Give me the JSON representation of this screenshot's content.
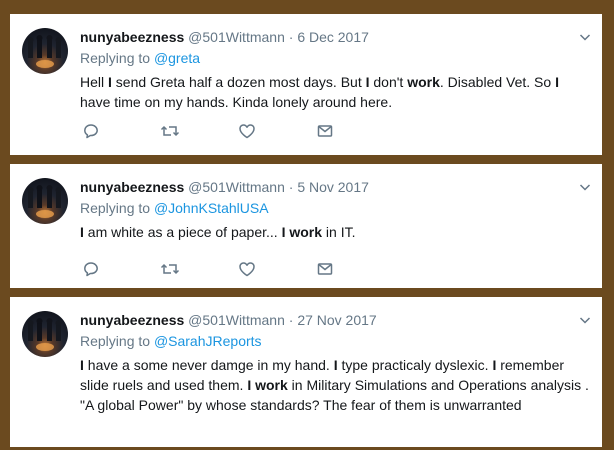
{
  "tweets": [
    {
      "name": "nunyabeezness",
      "handle": "@501Wittmann",
      "sep": "·",
      "date": "6 Dec 2017",
      "replying_label": "Replying to ",
      "replying_to": "@greta",
      "text": [
        {
          "t": "Hell ",
          "b": false
        },
        {
          "t": "I",
          "b": true
        },
        {
          "t": " send Greta half a dozen most days.  But ",
          "b": false
        },
        {
          "t": "I",
          "b": true
        },
        {
          "t": " don't ",
          "b": false
        },
        {
          "t": "work",
          "b": true
        },
        {
          "t": ". Disabled Vet. So ",
          "b": false
        },
        {
          "t": "I",
          "b": true
        },
        {
          "t": " have time on my hands. Kinda lonely around here.",
          "b": false
        }
      ]
    },
    {
      "name": "nunyabeezness",
      "handle": "@501Wittmann",
      "sep": "·",
      "date": "5 Nov 2017",
      "replying_label": "Replying to ",
      "replying_to": "@JohnKStahlUSA",
      "text": [
        {
          "t": "I",
          "b": true
        },
        {
          "t": " am white as a piece of paper... ",
          "b": false
        },
        {
          "t": "I",
          "b": true
        },
        {
          "t": " ",
          "b": false
        },
        {
          "t": "work",
          "b": true
        },
        {
          "t": " in IT.",
          "b": false
        }
      ]
    },
    {
      "name": "nunyabeezness",
      "handle": "@501Wittmann",
      "sep": "·",
      "date": "27 Nov 2017",
      "replying_label": "Replying to ",
      "replying_to": "@SarahJReports",
      "text": [
        {
          "t": "I",
          "b": true
        },
        {
          "t": " have a some never damge in my hand. ",
          "b": false
        },
        {
          "t": "I",
          "b": true
        },
        {
          "t": " type practicaly dyslexic. ",
          "b": false
        },
        {
          "t": "I",
          "b": true
        },
        {
          "t": " remember slide ruels and used them. ",
          "b": false
        },
        {
          "t": "I",
          "b": true
        },
        {
          "t": " ",
          "b": false
        },
        {
          "t": "work",
          "b": true
        },
        {
          "t": " in Military Simulations and Operations analysis .  \"A global Power\" by whose standards? The fear of them is unwarranted",
          "b": false
        }
      ]
    }
  ],
  "icons": [
    "reply-icon",
    "retweet-icon",
    "like-icon",
    "message-icon",
    "chevron-down-icon"
  ],
  "colors": {
    "background": "#6b4a1f",
    "card": "#ffffff",
    "link": "#1b95e0",
    "muted": "#657786",
    "text": "#14171a"
  }
}
